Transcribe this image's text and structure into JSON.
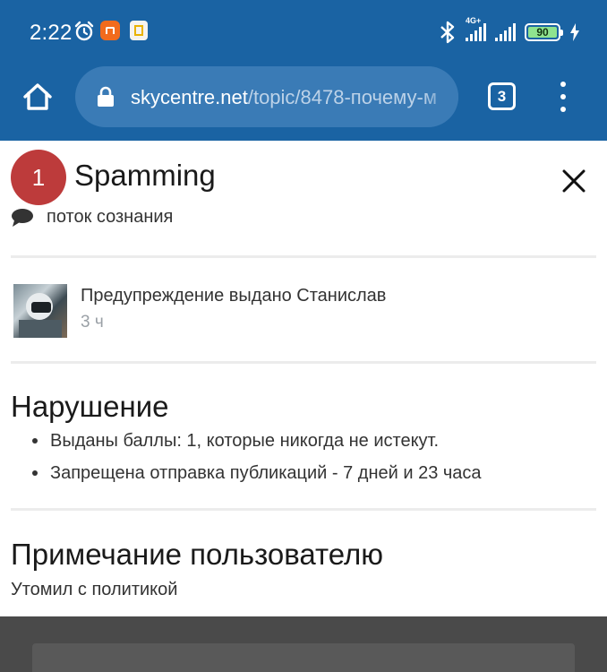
{
  "status_bar": {
    "time": "2:22",
    "network_label": "4G+",
    "battery_level": "90",
    "icons": [
      "alarm-icon",
      "mi-app-icon",
      "sim-toolkit-icon",
      "bluetooth-icon",
      "signal-icon",
      "battery-icon",
      "charging-icon"
    ]
  },
  "browser": {
    "url_host": "skycentre.net",
    "url_path": "/topic/8478-почему-м",
    "tab_count": "3"
  },
  "notice": {
    "count": "1",
    "title": "Spamming",
    "stream_label": "поток сознания",
    "warning_text": "Предупреждение выдано Станислав",
    "warning_time": "3 ч"
  },
  "violation": {
    "heading": "Нарушение",
    "items": [
      "Выданы баллы: 1, которые никогда не истекут.",
      "Запрещена отправка публикаций - 7 дней и 23 часа"
    ]
  },
  "user_note": {
    "heading": "Примечание пользователю",
    "text": "Утомил с политикой"
  },
  "colors": {
    "toolbar": "#1a63a3",
    "omnibox": "#3a7bb6",
    "badge": "#bd3b3b"
  }
}
